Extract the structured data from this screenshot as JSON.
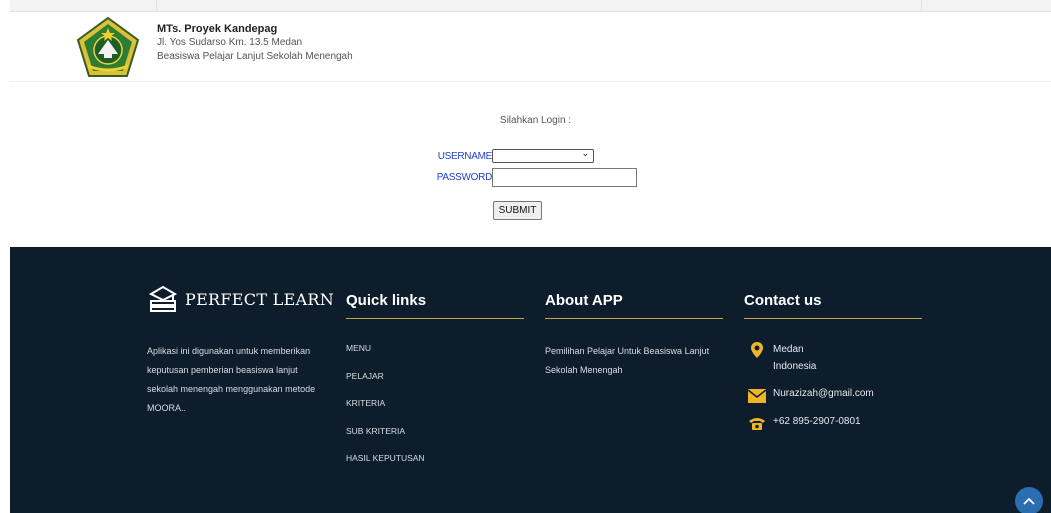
{
  "header": {
    "school_name": "MTs. Proyek Kandepag",
    "address": "Jl. Yos Sudarso Km. 13.5 Medan",
    "subtitle": "Beasiswa Pelajar Lanjut Sekolah Menengah"
  },
  "login": {
    "prompt": "Silahkan Login :",
    "username_label": "USERNAME",
    "password_label": "PASSWORD",
    "username_value": "",
    "password_value": "",
    "submit_label": "SUBMIT"
  },
  "footer": {
    "brand": "PERFECT LEARN",
    "about_text": "Aplikasi ini digunakan untuk memberikan keputusan pemberian beasiswa lanjut sekolah menengah menggunakan metode MOORA..",
    "quick_links_title": "Quick links",
    "quick_links": [
      "MENU",
      "PELAJAR",
      "KRITERIA",
      "SUB KRITERIA",
      "HASIL KEPUTUSAN"
    ],
    "about_app_title": "About APP",
    "about_app_text": "Pemilihan Pelajar Untuk Beasiswa Lanjut Sekolah Menengah",
    "contact_title": "Contact us",
    "contact": {
      "location_line1": "Medan",
      "location_line2": "Indonesia",
      "email": "Nurazizah@gmail.com",
      "phone": "+62 895-2907-0801"
    }
  },
  "colors": {
    "footer_bg": "#0e1d2c",
    "accent_gold": "#c9a349",
    "label_blue": "#1f3fd6",
    "scroll_button": "#2a6db0"
  }
}
